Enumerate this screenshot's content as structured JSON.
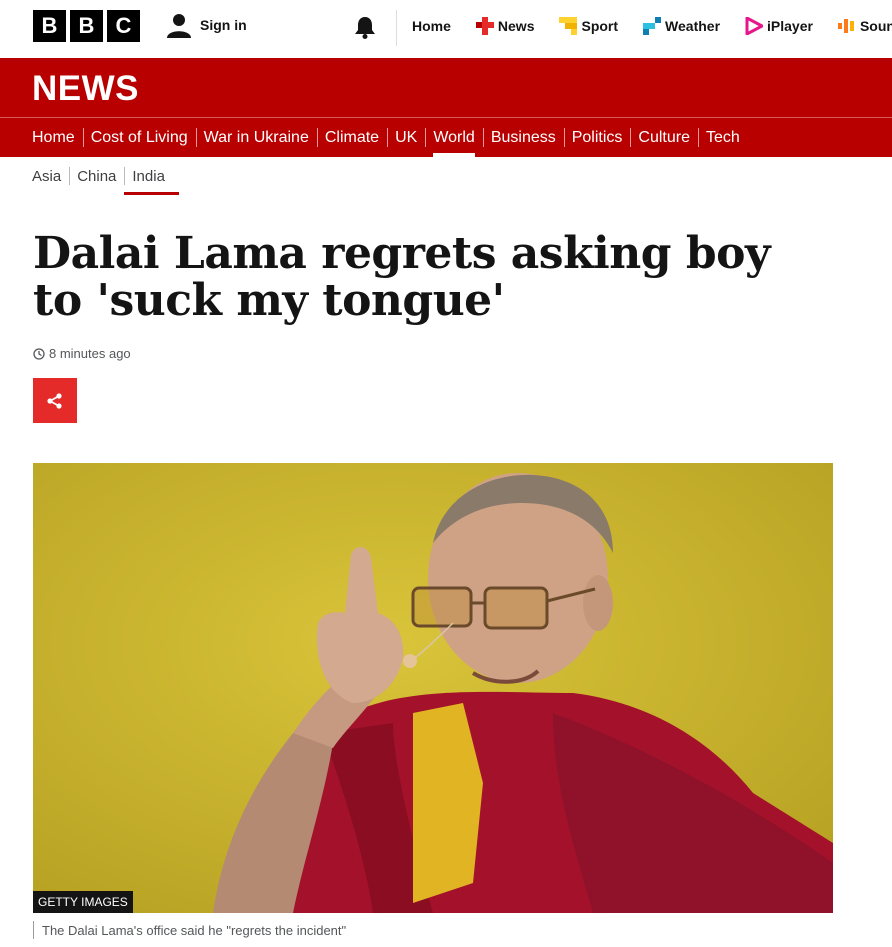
{
  "topbar": {
    "logo_letters": [
      "B",
      "B",
      "C"
    ],
    "signin_label": "Sign in",
    "nav": [
      {
        "label": "Home",
        "icon": "none"
      },
      {
        "label": "News",
        "icon": "news-cross-icon",
        "color": "#e52a2a"
      },
      {
        "label": "Sport",
        "icon": "sport-icon",
        "color": "#ffd230"
      },
      {
        "label": "Weather",
        "icon": "weather-icon",
        "color": "#0f7fb3"
      },
      {
        "label": "iPlayer",
        "icon": "iplayer-icon",
        "color": "#e6178b"
      },
      {
        "label": "Soun",
        "icon": "sounds-icon",
        "color": "#ff7a1a"
      }
    ]
  },
  "newsband": {
    "title": "NEWS",
    "sections": [
      "Home",
      "Cost of Living",
      "War in Ukraine",
      "Climate",
      "UK",
      "World",
      "Business",
      "Politics",
      "Culture",
      "Tech"
    ],
    "active_section": "World"
  },
  "subnav": {
    "items": [
      "Asia",
      "China",
      "India"
    ],
    "active": "India"
  },
  "article": {
    "headline": "Dalai Lama regrets asking boy to 'suck my tongue'",
    "timestamp": "8 minutes ago",
    "image_credit": "GETTY IMAGES",
    "caption": "The Dalai Lama's office said he \"regrets the incident\""
  },
  "colors": {
    "brand_red": "#b80000",
    "share_red": "#e52a2a"
  }
}
